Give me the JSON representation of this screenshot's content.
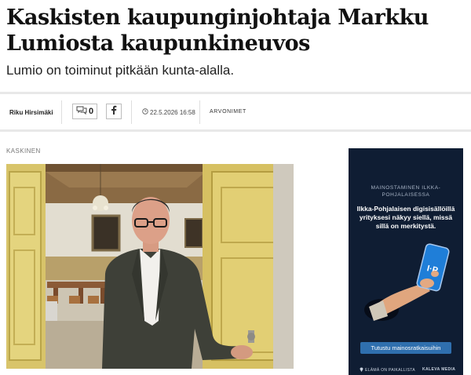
{
  "article": {
    "headline": "Kaskisten kaupunginjohtaja Markku Lumiosta kaupunkineuvos",
    "lead": "Lumio on toiminut pitkään kunta-alalla."
  },
  "meta": {
    "author": "Riku Hirsimäki",
    "comment_count": "0",
    "facebook_icon": "facebook-icon",
    "comment_icon": "speech-bubble-icon",
    "clock_icon": "clock-icon",
    "date": "22.5.2026 16:58",
    "tag": "ARVONIMET"
  },
  "section": {
    "label": "KASKINEN"
  },
  "photo": {
    "subject": "man-in-doorway-photo"
  },
  "ad": {
    "overline": "MAINOSTAMINEN ILKKA-POHJALAISESSA",
    "body": "Ilkka-Pohjalaisen digisisällöillä yrityksesi näkyy siellä, missä sillä on merkitystä.",
    "phone_logo": "I·P",
    "cta": "Tutustu mainosratkaisuihin",
    "footer_left": "ELÄMÄ ON PAIKALLISTA",
    "footer_right": "KALEVA MEDIA",
    "background": "#0f1d33",
    "cta_color": "#2f6fae"
  }
}
